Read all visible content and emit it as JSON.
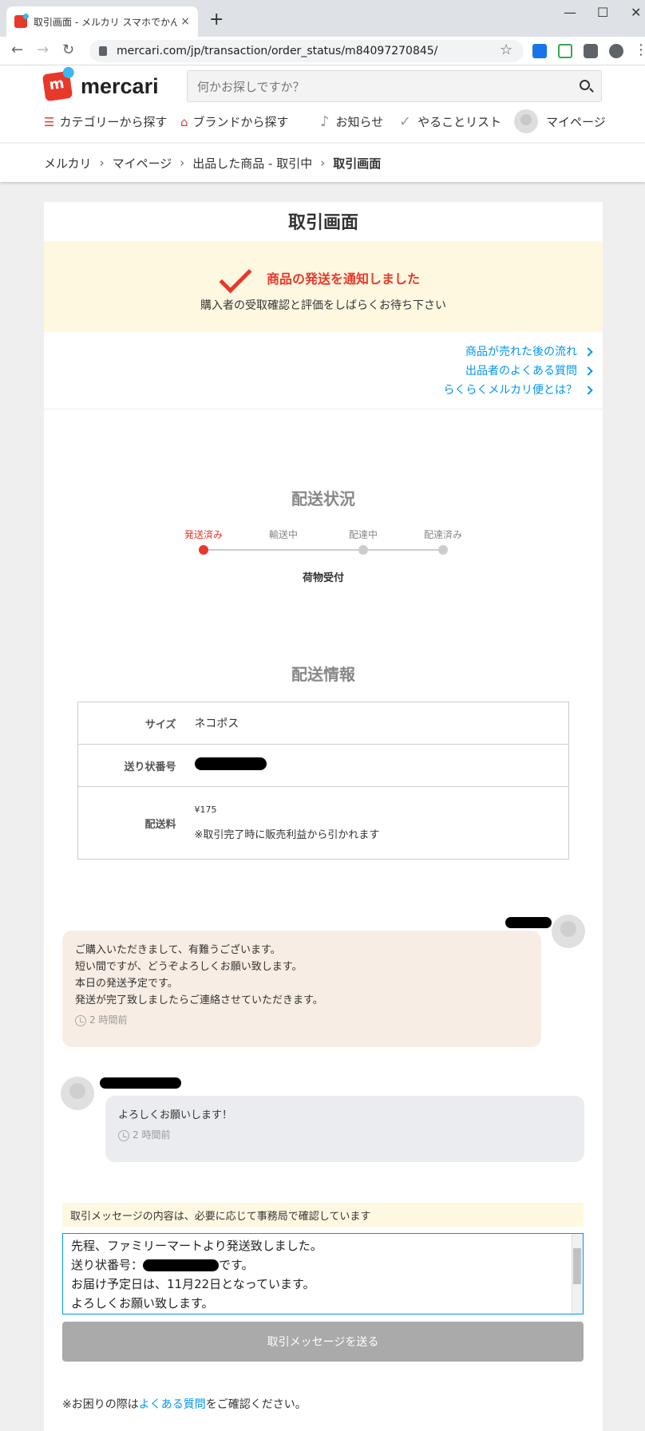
{
  "browser": {
    "tab_title": "取引画面 - メルカリ スマホでかんたん フ",
    "url": "mercari.com/jp/transaction/order_status/m84097270845/",
    "tab_close": "×",
    "new_tab": "+",
    "win_min": "—",
    "win_max": "☐",
    "win_close": "✕"
  },
  "header": {
    "logo_text": "mercari",
    "search_placeholder": "何かお探しですか？",
    "nav": {
      "category": "カテゴリーから探す",
      "brand": "ブランドから探す",
      "notifications": "お知らせ",
      "todo": "やることリスト",
      "mypage": "マイページ"
    }
  },
  "breadcrumb": [
    "メルカリ",
    "マイページ",
    "出品した商品 - 取引中",
    "取引画面"
  ],
  "page": {
    "title": "取引画面",
    "notice_title": "商品の発送を通知しました",
    "notice_sub": "購入者の受取確認と評価をしばらくお待ち下さい",
    "links": [
      "商品が売れた後の流れ",
      "出品者のよくある質問",
      "らくらくメルカリ便とは？"
    ]
  },
  "shipping_status": {
    "title": "配送状況",
    "steps": [
      "発送済み",
      "輸送中",
      "配達中",
      "配達済み"
    ],
    "current_step": 0,
    "status_text": "荷物受付"
  },
  "shipping_info": {
    "title": "配送情報",
    "size_label": "サイズ",
    "size_value": "ネコポス",
    "tracking_label": "送り状番号",
    "fee_label": "配送料",
    "fee_value": "¥175",
    "fee_note": "※取引完了時に販売利益から引かれます"
  },
  "messages": [
    {
      "lines": [
        "ご購入いただきまして、有難うございます。",
        "短い間ですが、どうぞよろしくお願い致します。",
        "本日の発送予定です。",
        "発送が完了致しましたらご連絡させていただきます。"
      ],
      "time": "2 時間前"
    },
    {
      "lines": [
        "よろしくお願いします！"
      ],
      "time": "2 時間前"
    }
  ],
  "compose": {
    "warning": "取引メッセージの内容は、必要に応じて事務局で確認しています",
    "line1": "先程、ファミリーマートより発送致しました。",
    "line2_prefix": "送り状番号：",
    "line2_suffix": "です。",
    "line3": "お届け予定日は、11月22日となっています。",
    "line4": "よろしくお願い致します。",
    "send_label": "取引メッセージを送る"
  },
  "help": {
    "prefix": "※お困りの際は",
    "link": "よくある質問",
    "suffix": "をご確認ください。"
  },
  "colors": {
    "brand_red": "#e8382a",
    "link_blue": "#0095ee"
  }
}
